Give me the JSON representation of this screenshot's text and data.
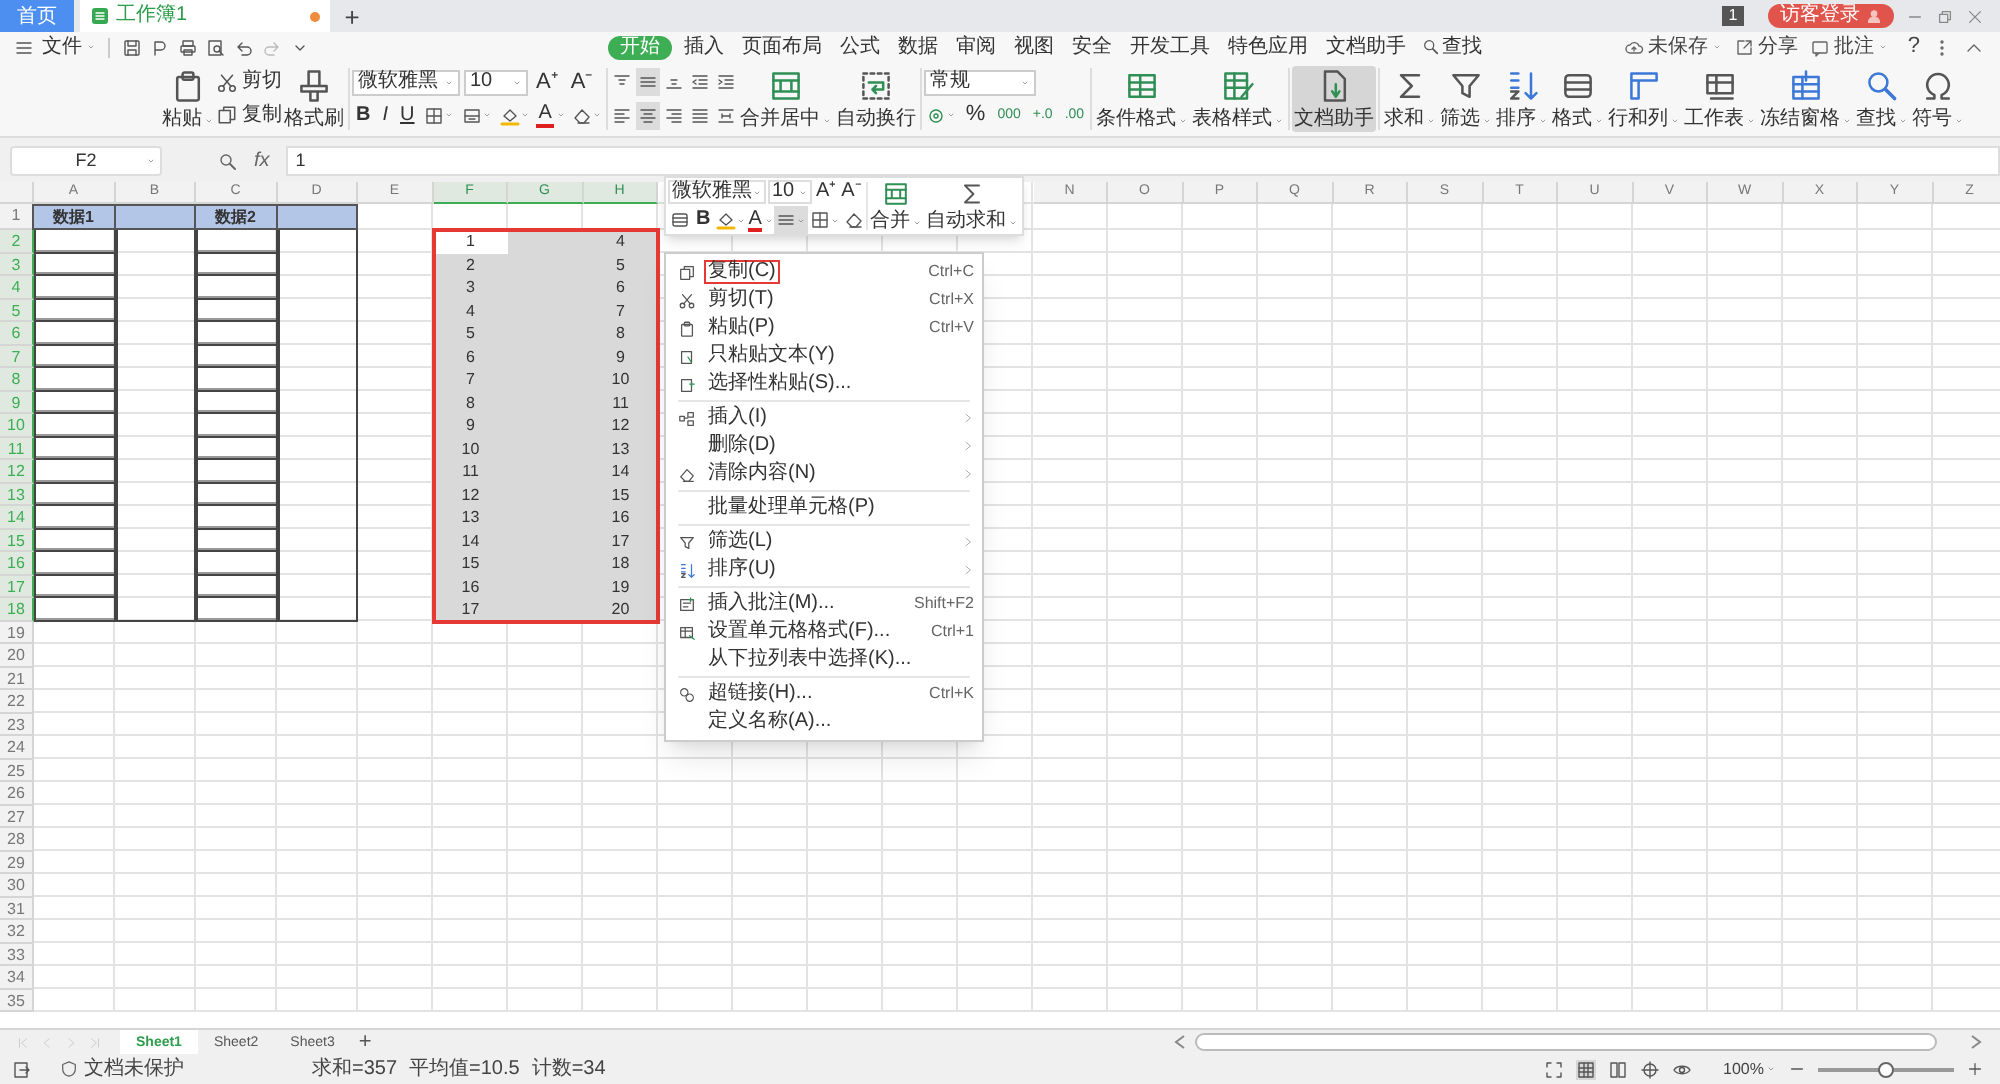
{
  "tab_bar": {
    "tabs": [
      {
        "label": "首页",
        "kind": "home",
        "selected": false,
        "modified": false
      },
      {
        "label": "工作簿1",
        "kind": "doc",
        "selected": true,
        "modified": true
      }
    ],
    "new_tab": "+",
    "badge": "1",
    "login": "访客登录"
  },
  "menu_bar": {
    "file": "文件",
    "ribbon_tabs": [
      {
        "label": "开始",
        "selected": true
      },
      {
        "label": "插入",
        "selected": false
      },
      {
        "label": "页面布局",
        "selected": false
      },
      {
        "label": "公式",
        "selected": false
      },
      {
        "label": "数据",
        "selected": false
      },
      {
        "label": "审阅",
        "selected": false
      },
      {
        "label": "视图",
        "selected": false
      },
      {
        "label": "安全",
        "selected": false
      },
      {
        "label": "开发工具",
        "selected": false
      },
      {
        "label": "特色应用",
        "selected": false
      },
      {
        "label": "文档助手",
        "selected": false
      }
    ],
    "search": "查找",
    "unsaved": "未保存",
    "share": "分享",
    "comment": "批注",
    "help": "?"
  },
  "ribbon": {
    "paste": "粘贴",
    "cut": "剪切",
    "copy": "复制",
    "format_painter": "格式刷",
    "font": "微软雅黑",
    "size": "10",
    "font_grow": "A⁺",
    "font_shrink": "A⁻",
    "text_styles": [
      "B",
      "I",
      "U"
    ],
    "font_color": "A",
    "merge": "合并居中",
    "wrap": "自动换行",
    "number_format": "常规",
    "number_buttons": [
      "%",
      "000",
      "+.0",
      ".00"
    ],
    "styles": [
      "条件格式",
      "表格样式"
    ],
    "assistant": {
      "label": "文档助手",
      "selected": true
    },
    "tools": [
      "求和",
      "筛选",
      "排序",
      "格式",
      "行和列",
      "工作表",
      "冻结窗格",
      "查找",
      "符号"
    ]
  },
  "formula_bar": {
    "name_box": "F2",
    "fx": "fx",
    "value": "1"
  },
  "sheet": {
    "columns": [
      {
        "label": "A",
        "selected": false
      },
      {
        "label": "B",
        "selected": false
      },
      {
        "label": "C",
        "selected": false
      },
      {
        "label": "D",
        "selected": false
      },
      {
        "label": "E",
        "selected": false
      },
      {
        "label": "F",
        "selected": true
      },
      {
        "label": "G",
        "selected": true
      },
      {
        "label": "H",
        "selected": true
      },
      {},
      {},
      {},
      {},
      {},
      {
        "label": "N",
        "selected": false
      },
      {
        "label": "O",
        "selected": false
      },
      {
        "label": "P",
        "selected": false
      },
      {
        "label": "Q",
        "selected": false
      },
      {
        "label": "R",
        "selected": false
      },
      {
        "label": "S",
        "selected": false
      },
      {
        "label": "T",
        "selected": false
      },
      {
        "label": "U",
        "selected": false
      },
      {
        "label": "V",
        "selected": false
      },
      {
        "label": "W",
        "selected": false
      },
      {
        "label": "X",
        "selected": false
      },
      {
        "label": "Y",
        "selected": false
      },
      {
        "label": "Z",
        "selected": false
      }
    ],
    "rows": [
      {
        "label": "1",
        "selected": false,
        "kind": "header",
        "cells": [
          {
            "text": "数据1"
          },
          null,
          {
            "text": "数据2"
          }
        ]
      },
      {
        "label": "2",
        "selected": true,
        "kind": "body",
        "cells": [
          null,
          null,
          null,
          null,
          null,
          {
            "text": "1",
            "active": true
          },
          null,
          {
            "text": "4"
          }
        ]
      },
      {
        "label": "3",
        "selected": true,
        "kind": "body",
        "cells": [
          null,
          null,
          null,
          null,
          null,
          {
            "text": "2"
          },
          null,
          {
            "text": "5"
          }
        ]
      },
      {
        "label": "4",
        "selected": true,
        "kind": "body",
        "cells": [
          null,
          null,
          null,
          null,
          null,
          {
            "text": "3"
          },
          null,
          {
            "text": "6"
          }
        ]
      },
      {
        "label": "5",
        "selected": true,
        "kind": "body",
        "cells": [
          null,
          null,
          null,
          null,
          null,
          {
            "text": "4"
          },
          null,
          {
            "text": "7"
          }
        ]
      },
      {
        "label": "6",
        "selected": true,
        "kind": "body",
        "cells": [
          null,
          null,
          null,
          null,
          null,
          {
            "text": "5"
          },
          null,
          {
            "text": "8"
          }
        ]
      },
      {
        "label": "7",
        "selected": true,
        "kind": "body",
        "cells": [
          null,
          null,
          null,
          null,
          null,
          {
            "text": "6"
          },
          null,
          {
            "text": "9"
          }
        ]
      },
      {
        "label": "8",
        "selected": true,
        "kind": "body",
        "cells": [
          null,
          null,
          null,
          null,
          null,
          {
            "text": "7"
          },
          null,
          {
            "text": "10"
          }
        ]
      },
      {
        "label": "9",
        "selected": true,
        "kind": "body",
        "cells": [
          null,
          null,
          null,
          null,
          null,
          {
            "text": "8"
          },
          null,
          {
            "text": "11"
          }
        ]
      },
      {
        "label": "10",
        "selected": true,
        "kind": "body",
        "cells": [
          null,
          null,
          null,
          null,
          null,
          {
            "text": "9"
          },
          null,
          {
            "text": "12"
          }
        ]
      },
      {
        "label": "11",
        "selected": true,
        "kind": "body",
        "cells": [
          null,
          null,
          null,
          null,
          null,
          {
            "text": "10"
          },
          null,
          {
            "text": "13"
          }
        ]
      },
      {
        "label": "12",
        "selected": true,
        "kind": "body",
        "cells": [
          null,
          null,
          null,
          null,
          null,
          {
            "text": "11"
          },
          null,
          {
            "text": "14"
          }
        ]
      },
      {
        "label": "13",
        "selected": true,
        "kind": "body",
        "cells": [
          null,
          null,
          null,
          null,
          null,
          {
            "text": "12"
          },
          null,
          {
            "text": "15"
          }
        ]
      },
      {
        "label": "14",
        "selected": true,
        "kind": "body",
        "cells": [
          null,
          null,
          null,
          null,
          null,
          {
            "text": "13"
          },
          null,
          {
            "text": "16"
          }
        ]
      },
      {
        "label": "15",
        "selected": true,
        "kind": "body",
        "cells": [
          null,
          null,
          null,
          null,
          null,
          {
            "text": "14"
          },
          null,
          {
            "text": "17"
          }
        ]
      },
      {
        "label": "16",
        "selected": true,
        "kind": "body",
        "cells": [
          null,
          null,
          null,
          null,
          null,
          {
            "text": "15"
          },
          null,
          {
            "text": "18"
          }
        ]
      },
      {
        "label": "17",
        "selected": true,
        "kind": "body",
        "cells": [
          null,
          null,
          null,
          null,
          null,
          {
            "text": "16"
          },
          null,
          {
            "text": "19"
          }
        ]
      },
      {
        "label": "18",
        "selected": true,
        "kind": "body",
        "cells": [
          null,
          null,
          null,
          null,
          null,
          {
            "text": "17"
          },
          null,
          {
            "text": "20"
          }
        ]
      },
      {
        "label": "19",
        "selected": false
      },
      {
        "label": "20",
        "selected": false
      },
      {
        "label": "21",
        "selected": false
      },
      {
        "label": "22",
        "selected": false
      },
      {
        "label": "23",
        "selected": false
      },
      {
        "label": "24",
        "selected": false
      },
      {
        "label": "25",
        "selected": false
      },
      {
        "label": "26",
        "selected": false
      },
      {
        "label": "27",
        "selected": false
      },
      {
        "label": "28",
        "selected": false
      },
      {
        "label": "29",
        "selected": false
      },
      {
        "label": "30",
        "selected": false
      },
      {
        "label": "31",
        "selected": false
      },
      {
        "label": "32",
        "selected": false
      },
      {
        "label": "33",
        "selected": false
      },
      {
        "label": "34",
        "selected": false
      },
      {
        "label": "35",
        "selected": false
      }
    ]
  },
  "mini_toolbar": {
    "font": "微软雅黑",
    "size": "10",
    "font_grow": "A⁺",
    "font_shrink": "A⁻",
    "bold": "B",
    "font_color": "A",
    "merge": "合并",
    "autosum": "自动求和"
  },
  "context_menu": [
    {
      "label": "复制(C)",
      "shortcut": "Ctrl+C",
      "outlined": true,
      "submenu": false,
      "separator_before": false
    },
    {
      "label": "剪切(T)",
      "shortcut": "Ctrl+X",
      "outlined": false,
      "submenu": false,
      "separator_before": false
    },
    {
      "label": "粘贴(P)",
      "shortcut": "Ctrl+V",
      "outlined": false,
      "submenu": false,
      "separator_before": false
    },
    {
      "label": "只粘贴文本(Y)",
      "outlined": false,
      "submenu": false,
      "separator_before": false
    },
    {
      "label": "选择性粘贴(S)...",
      "outlined": false,
      "submenu": false,
      "separator_before": false
    },
    {
      "label": "插入(I)",
      "outlined": false,
      "submenu": true,
      "separator_before": true
    },
    {
      "label": "删除(D)",
      "outlined": false,
      "submenu": true,
      "separator_before": false
    },
    {
      "label": "清除内容(N)",
      "outlined": false,
      "submenu": true,
      "separator_before": false
    },
    {
      "label": "批量处理单元格(P)",
      "outlined": false,
      "submenu": false,
      "separator_before": true
    },
    {
      "label": "筛选(L)",
      "outlined": false,
      "submenu": true,
      "separator_before": true
    },
    {
      "label": "排序(U)",
      "outlined": false,
      "submenu": true,
      "separator_before": false
    },
    {
      "label": "插入批注(M)...",
      "shortcut": "Shift+F2",
      "outlined": false,
      "submenu": false,
      "separator_before": true
    },
    {
      "label": "设置单元格格式(F)...",
      "shortcut": "Ctrl+1",
      "outlined": false,
      "submenu": false,
      "separator_before": false
    },
    {
      "label": "从下拉列表中选择(K)...",
      "outlined": false,
      "submenu": false,
      "separator_before": false
    },
    {
      "label": "超链接(H)...",
      "shortcut": "Ctrl+K",
      "outlined": false,
      "submenu": false,
      "separator_before": true
    },
    {
      "label": "定义名称(A)...",
      "outlined": false,
      "submenu": false,
      "separator_before": false
    }
  ],
  "sheet_tabs": [
    {
      "label": "Sheet1",
      "selected": true
    },
    {
      "label": "Sheet2",
      "selected": false
    },
    {
      "label": "Sheet3",
      "selected": false
    }
  ],
  "add_sheet": "+",
  "status_bar": {
    "protection": "文档未保护",
    "stats": [
      "求和=357",
      "平均值=10.5",
      "计数=34"
    ],
    "zoom": "100%",
    "zoom_level": {
      "level": 0.5
    }
  }
}
